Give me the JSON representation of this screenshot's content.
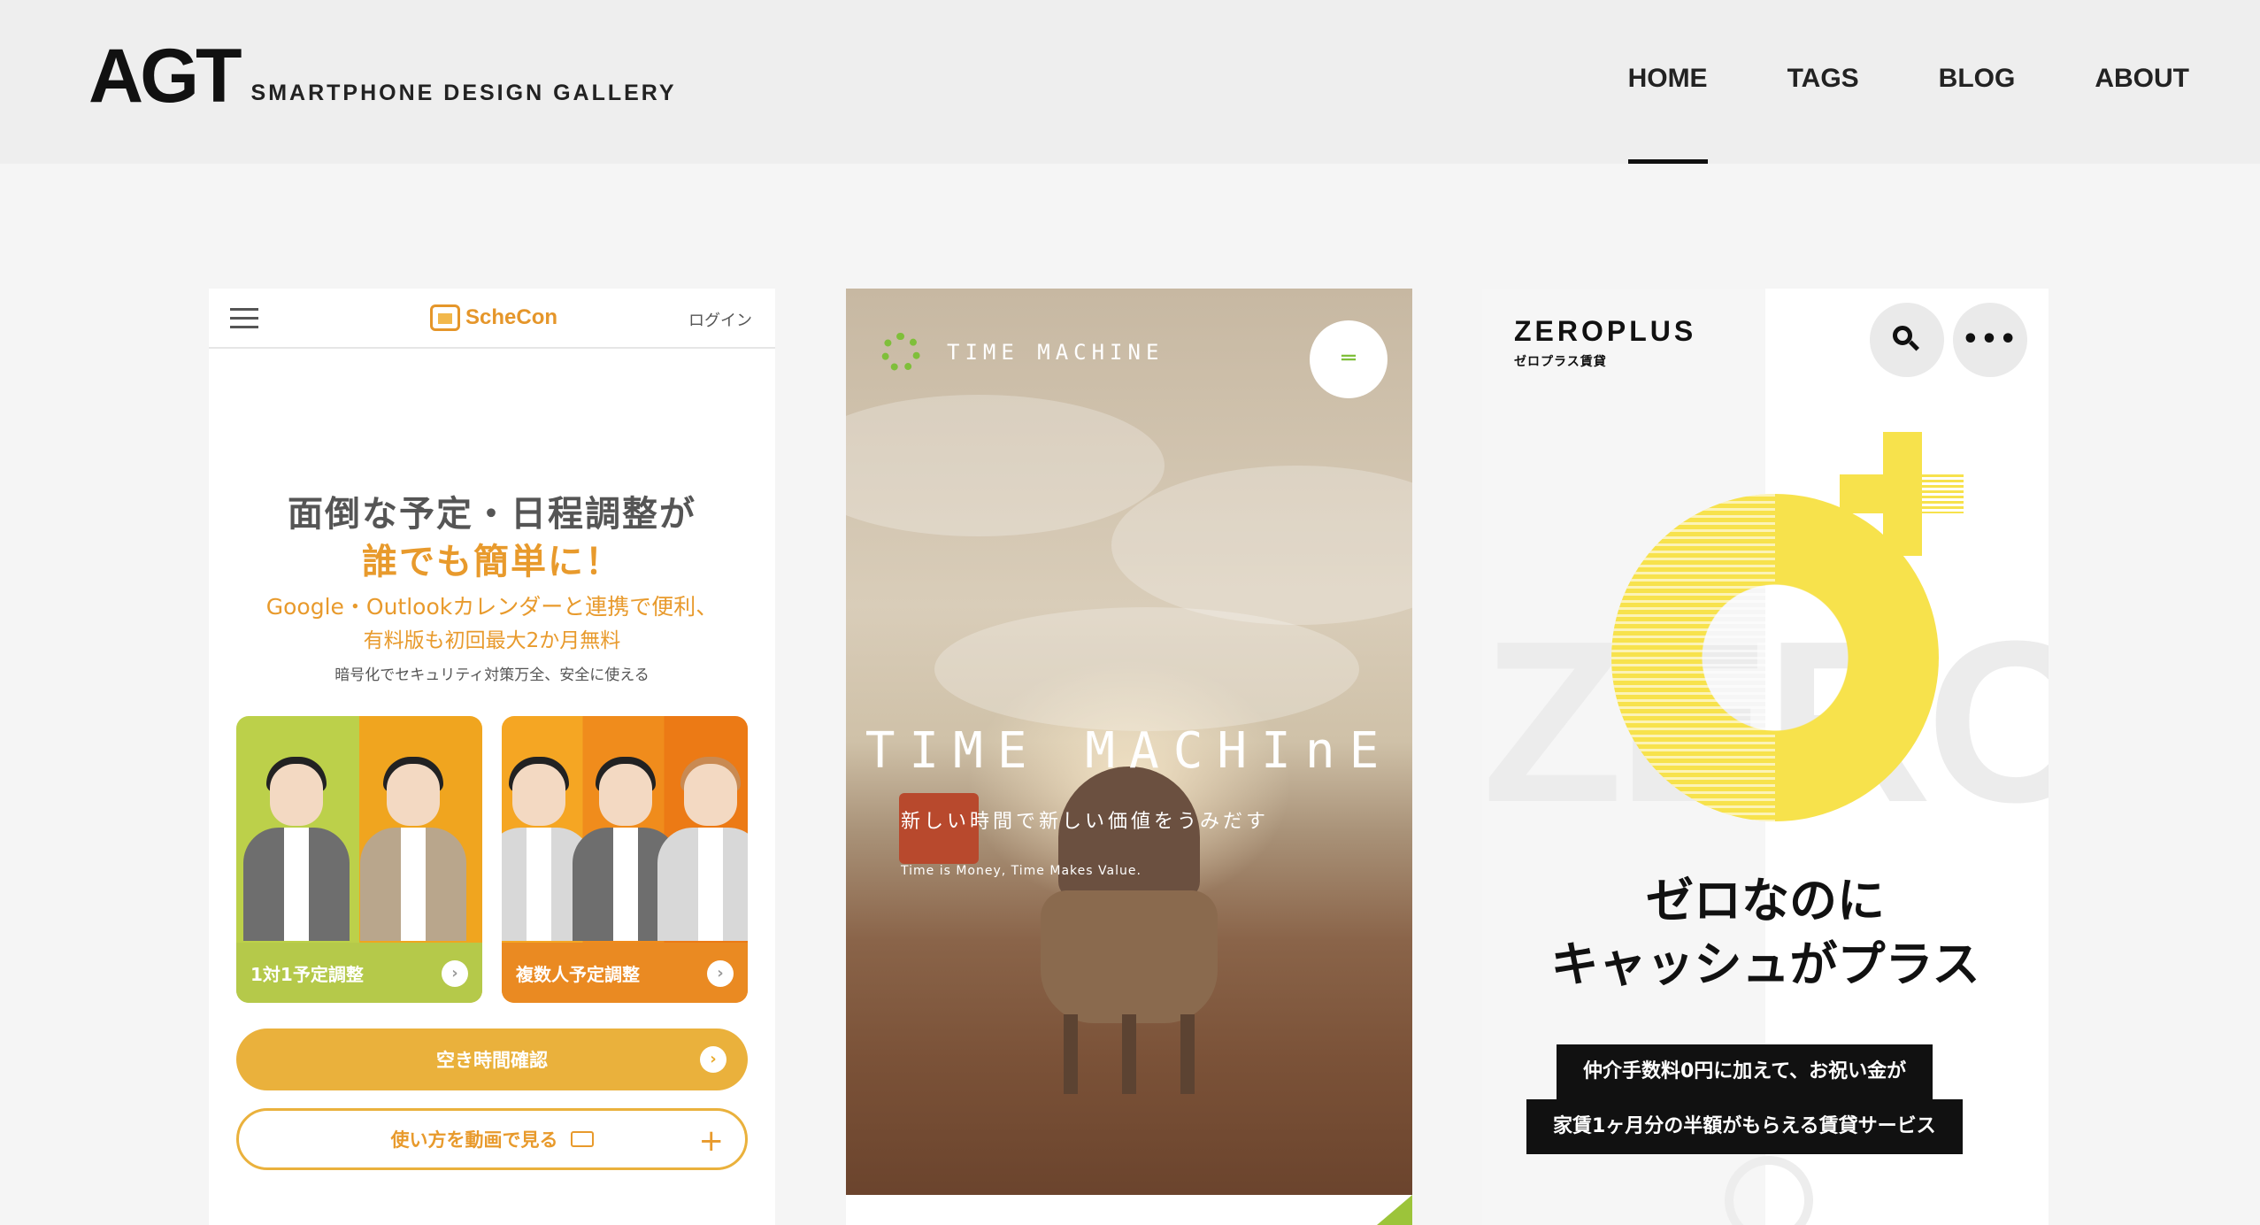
{
  "header": {
    "logo_mark": "AGT",
    "logo_tagline": "SMARTPHONE DESIGN GALLERY",
    "nav": [
      {
        "label": "HOME",
        "active": true
      },
      {
        "label": "TAGS",
        "active": false
      },
      {
        "label": "BLOG",
        "active": false
      },
      {
        "label": "ABOUT",
        "active": false
      }
    ]
  },
  "cards": [
    {
      "brand": "ScheCon",
      "login": "ログイン",
      "headline_1": "面倒な予定・日程調整が",
      "headline_2": "誰でも簡単に！",
      "sub_1": "Google・Outlookカレンダーと連携で便利、",
      "sub_2": "有料版も初回最大2か月無料",
      "sub_3": "暗号化でセキュリティ対策万全、安全に使える",
      "tile_1_label": "1対1予定調整",
      "tile_2_label": "複数人予定調整",
      "button_primary": "空き時間確認",
      "button_secondary": "使い方を動画で見る",
      "accent_color": "#eab13c"
    },
    {
      "brand": "TIME MACHINE",
      "hero_title": "TIME MACHInE",
      "hero_sub": "新しい時間で新しい価値をうみだす",
      "hero_tiny": "Time is Money, Time Makes Value.",
      "accent_color": "#7fbf3a"
    },
    {
      "brand": "ZEROPLUS",
      "brand_sub": "ゼロプラス賃貸",
      "bg_letters": "ZERO",
      "headline_1": "ゼロなのに",
      "headline_2": "キャッシュがプラス",
      "tag_1": "仲介手数料0円に加えて、お祝い金が",
      "tag_2": "家賃1ヶ月分の半額がもらえる賃貸サービス",
      "accent_color": "#f7e24c"
    }
  ],
  "icons": [
    "hamburger-icon",
    "arrow-right-icon",
    "video-icon",
    "plus-icon",
    "menu-icon",
    "search-icon",
    "more-icon"
  ]
}
